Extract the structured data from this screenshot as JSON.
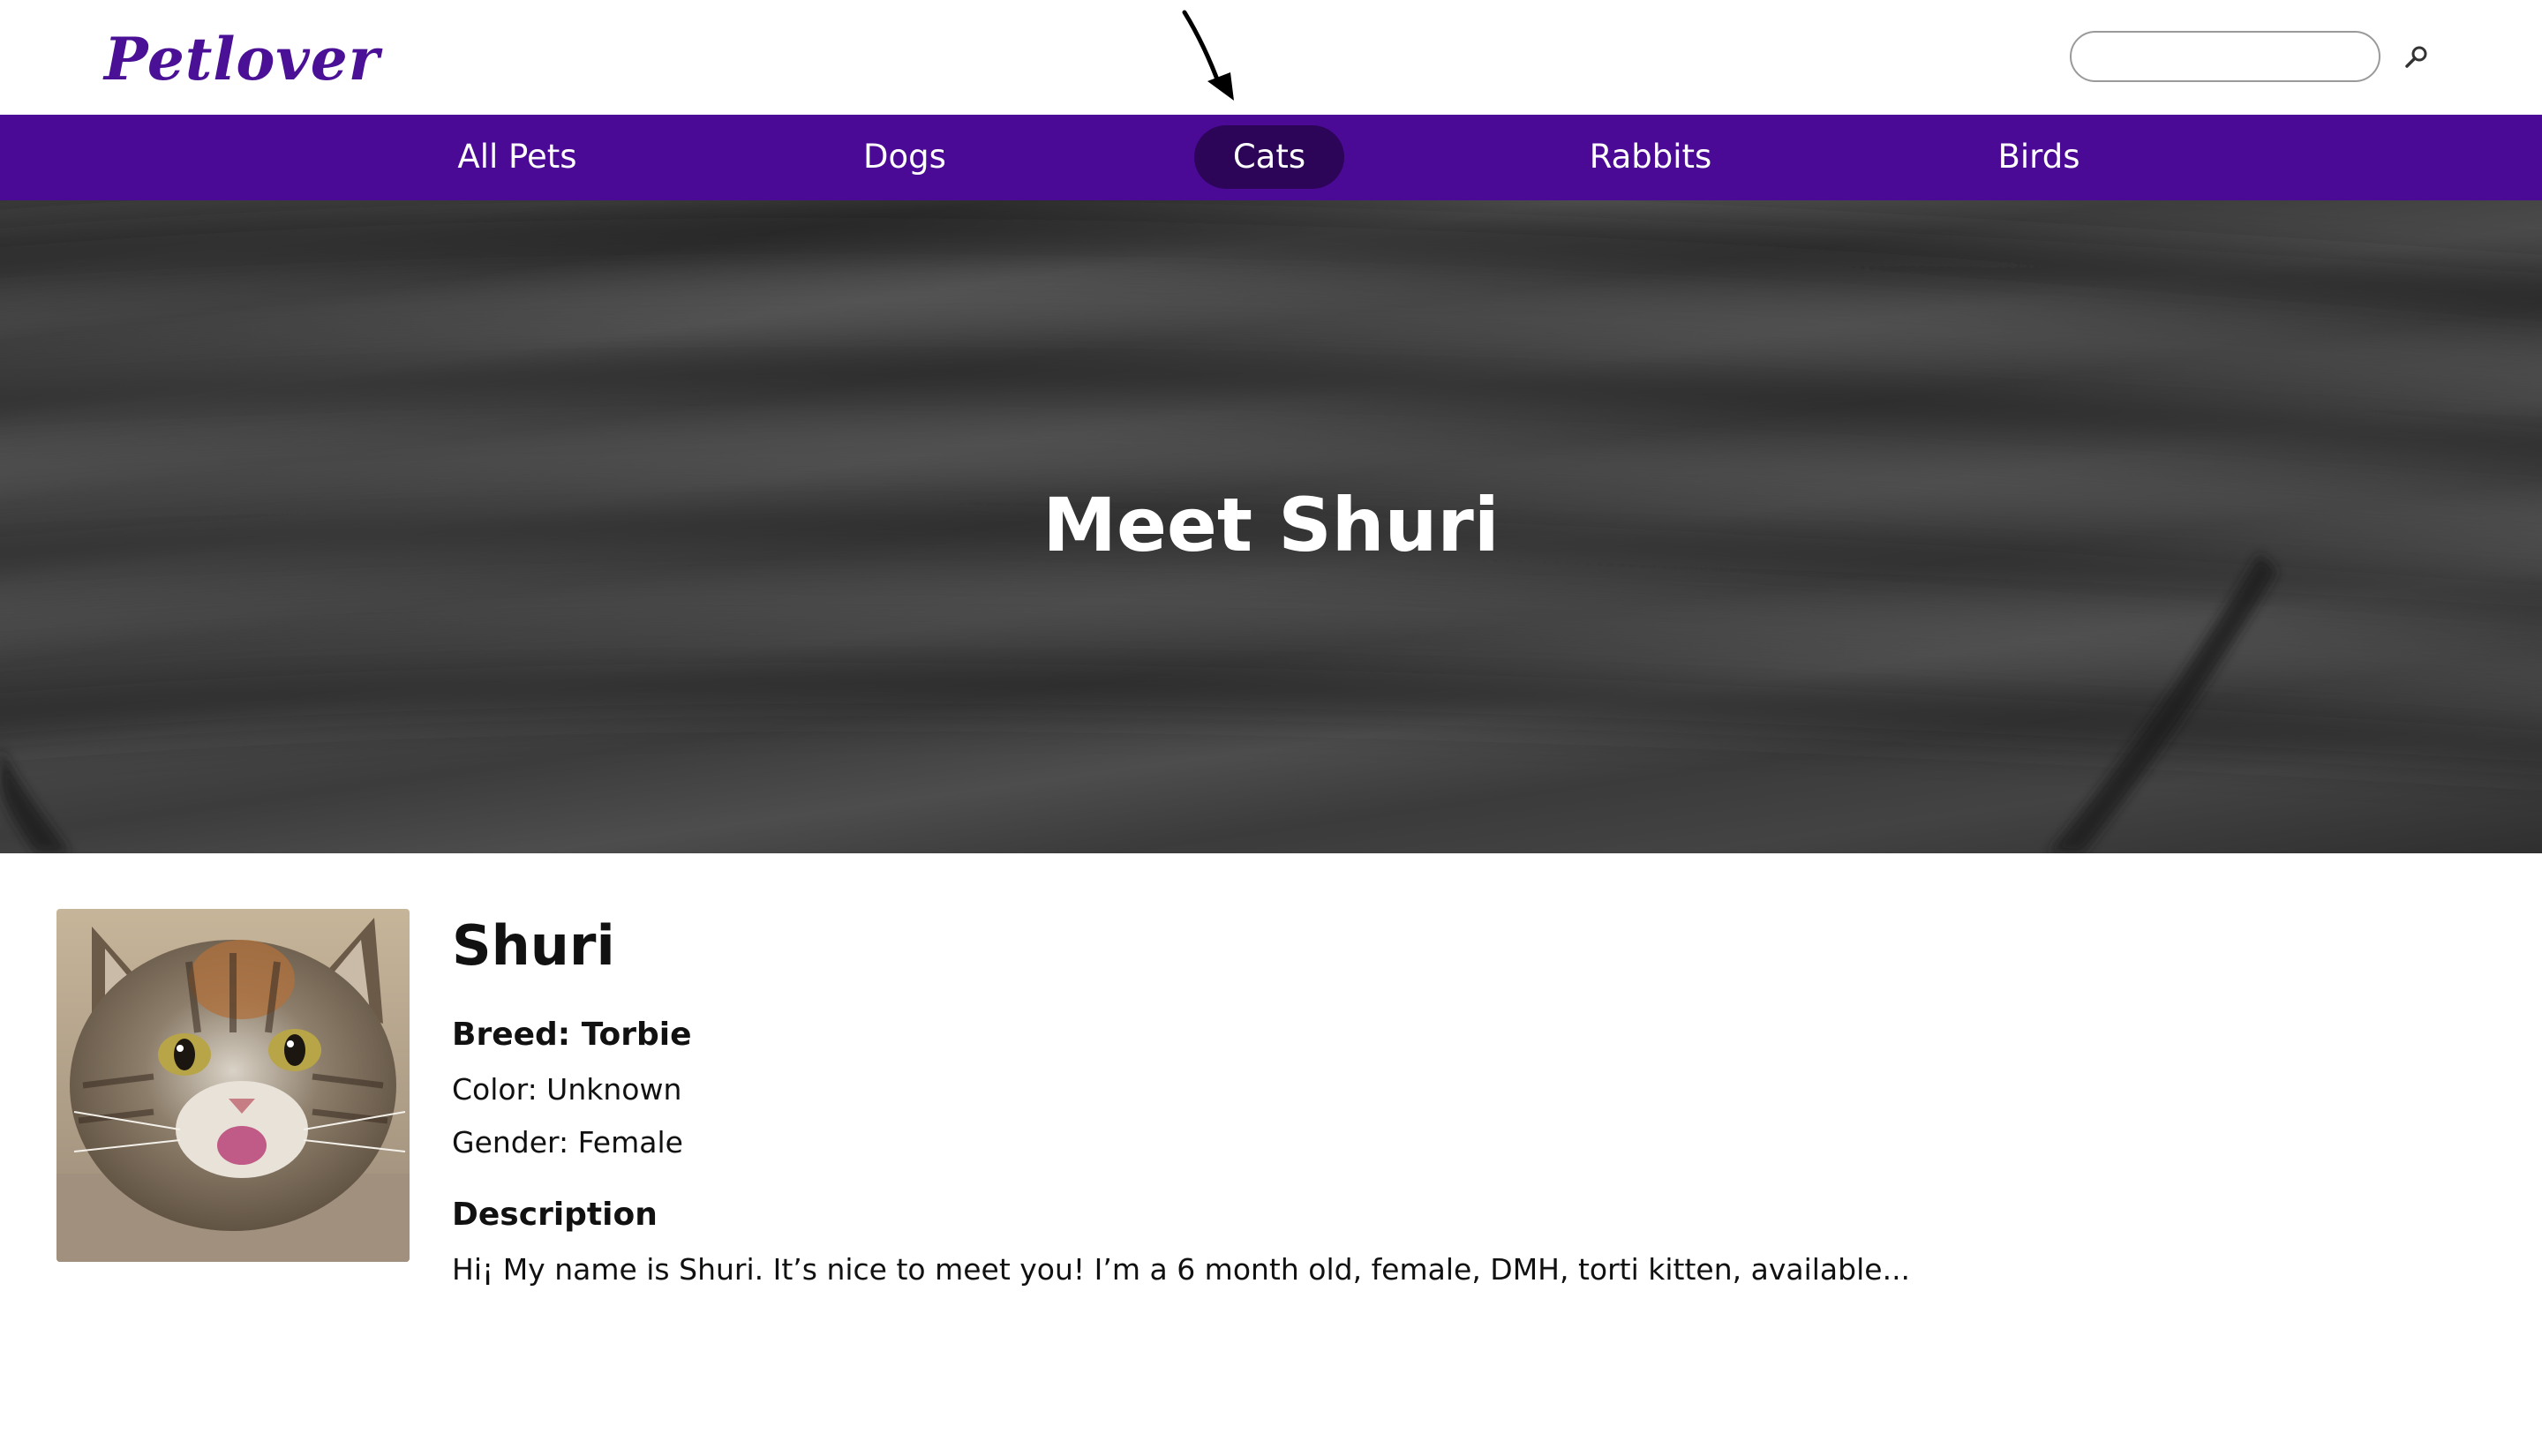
{
  "header": {
    "logo_text": "Petlover",
    "search_placeholder": "",
    "search_value": ""
  },
  "nav": {
    "items": [
      {
        "label": "All Pets"
      },
      {
        "label": "Dogs"
      },
      {
        "label": "Cats",
        "active": true
      },
      {
        "label": "Rabbits"
      },
      {
        "label": "Birds"
      }
    ]
  },
  "hero": {
    "title": "Meet Shuri"
  },
  "pet": {
    "name": "Shuri",
    "breed": "Breed: Torbie",
    "color": "Color: Unknown",
    "gender": "Gender: Female",
    "description_heading": "Description",
    "description": "Hi¡ My name is Shuri. It’s nice to meet you! I’m a 6 month old, female, DMH, torti kitten, available..."
  },
  "colors": {
    "brand_purple": "#4b0a96",
    "nav_active": "#2c0558",
    "logo": "#4a1196"
  },
  "icons": {
    "search": "search-icon",
    "annotation": "arrow-annotation-icon"
  }
}
